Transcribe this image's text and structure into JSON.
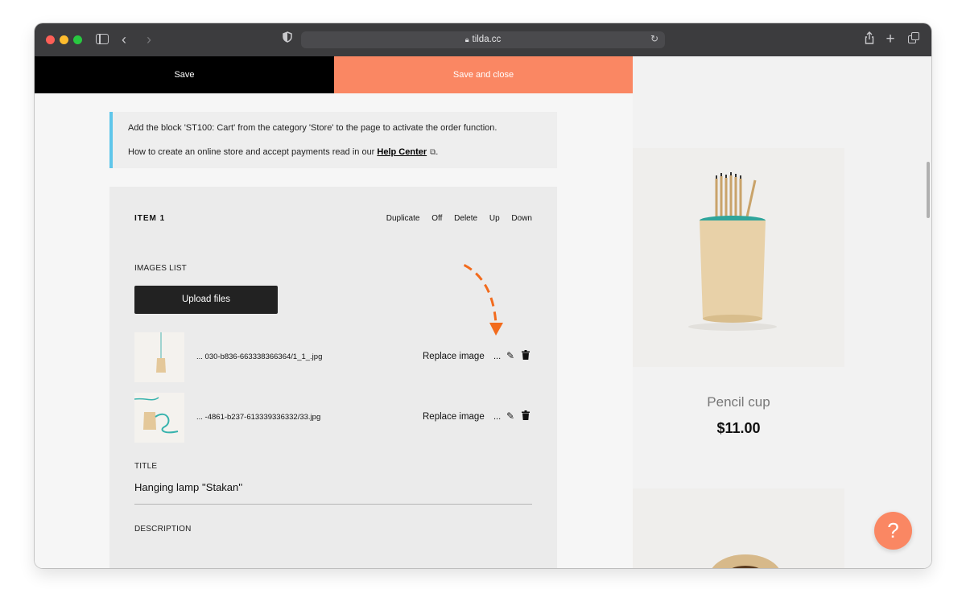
{
  "browser": {
    "url": "tilda.cc",
    "icons": [
      "sidebar-icon",
      "back-icon",
      "forward-icon",
      "shield-icon",
      "lock-icon",
      "reload-icon",
      "share-icon",
      "plus-icon",
      "tabs-icon"
    ]
  },
  "topbar": {
    "save_label": "Save",
    "save_close_label": "Save and close",
    "accent_color": "#fa8763"
  },
  "notice": {
    "line1": "Add the block 'ST100: Cart' from the category 'Store' to the page to activate the order function.",
    "line2_prefix": "How to create an online store and accept payments read in our ",
    "help_link": "Help Center",
    "line2_suffix": ".",
    "accent_color": "#5fc6ea"
  },
  "item": {
    "title": "ITEM 1",
    "actions": {
      "duplicate": "Duplicate",
      "off": "Off",
      "delete": "Delete",
      "up": "Up",
      "down": "Down"
    },
    "images_label": "IMAGES LIST",
    "upload_label": "Upload files",
    "images": [
      {
        "filename": "... 030-b836-663338366364/1_1_.jpg",
        "replace": "Replace image",
        "more": "..."
      },
      {
        "filename": "... -4861-b237-613339336332/33.jpg",
        "replace": "Replace image",
        "more": "..."
      }
    ],
    "title_label": "TITLE",
    "title_value": "Hanging lamp ''Stakan''",
    "description_label": "DESCRIPTION"
  },
  "preview": {
    "product_name": "Pencil cup",
    "product_price": "$11.00",
    "help_button": "?"
  }
}
